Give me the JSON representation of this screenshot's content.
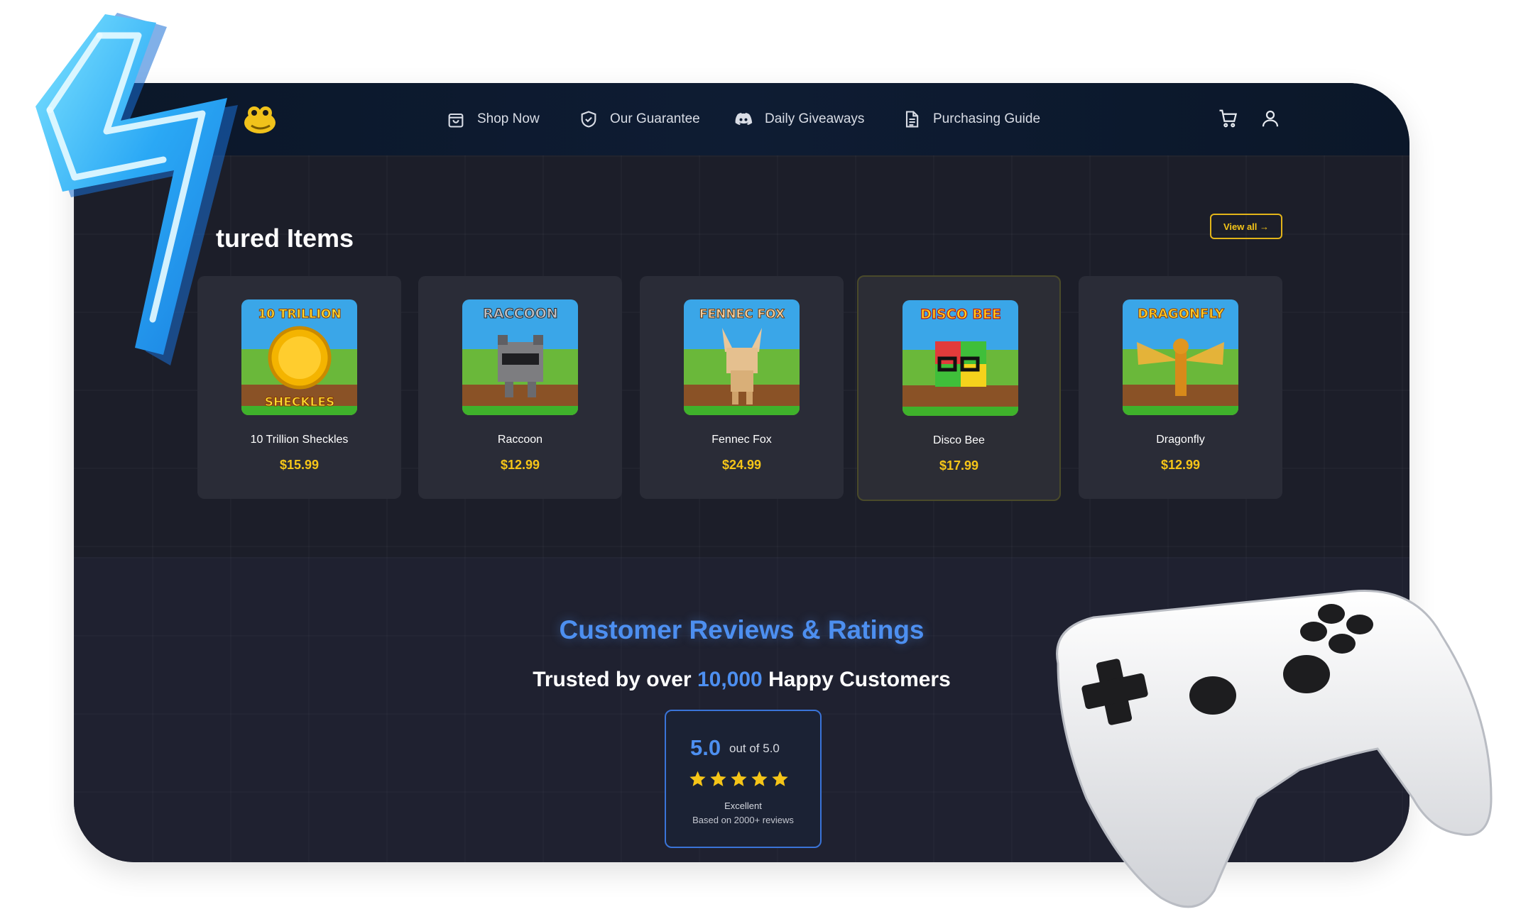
{
  "nav": {
    "links": [
      {
        "label": "Shop Now",
        "icon": "shopping-bag-icon"
      },
      {
        "label": "Our Guarantee",
        "icon": "shield-icon"
      },
      {
        "label": "Daily Giveaways",
        "icon": "discord-icon"
      },
      {
        "label": "Purchasing Guide",
        "icon": "document-icon"
      }
    ],
    "cart_icon": "cart-icon",
    "account_icon": "user-icon"
  },
  "featured": {
    "title": "tured Items",
    "view_all": "View all →",
    "items": [
      {
        "name": "10 Trillion Sheckles",
        "price": "$15.99",
        "art_title": "10 TRILLION",
        "art_subtitle": "SHECKLES"
      },
      {
        "name": "Raccoon",
        "price": "$12.99",
        "art_title": "RACCOON"
      },
      {
        "name": "Fennec Fox",
        "price": "$24.99",
        "art_title": "FENNEC FOX"
      },
      {
        "name": "Disco Bee",
        "price": "$17.99",
        "art_title": "DISCO BEE"
      },
      {
        "name": "Dragonfly",
        "price": "$12.99",
        "art_title": "DRAGONFLY"
      }
    ]
  },
  "reviews": {
    "title": "Customer Reviews & Ratings",
    "subtitle_prefix": "Trusted by over",
    "subtitle_highlight": "10,000",
    "subtitle_suffix": "Happy Customers",
    "score": "5.0",
    "out_of": "out of 5.0",
    "stars": 5,
    "label": "Excellent",
    "count": "Based on 2000+ reviews"
  },
  "colors": {
    "accent_gold": "#f5c518",
    "accent_blue": "#4d8ff0",
    "background": "#1c1e29",
    "navbar": "#0e1c33"
  }
}
